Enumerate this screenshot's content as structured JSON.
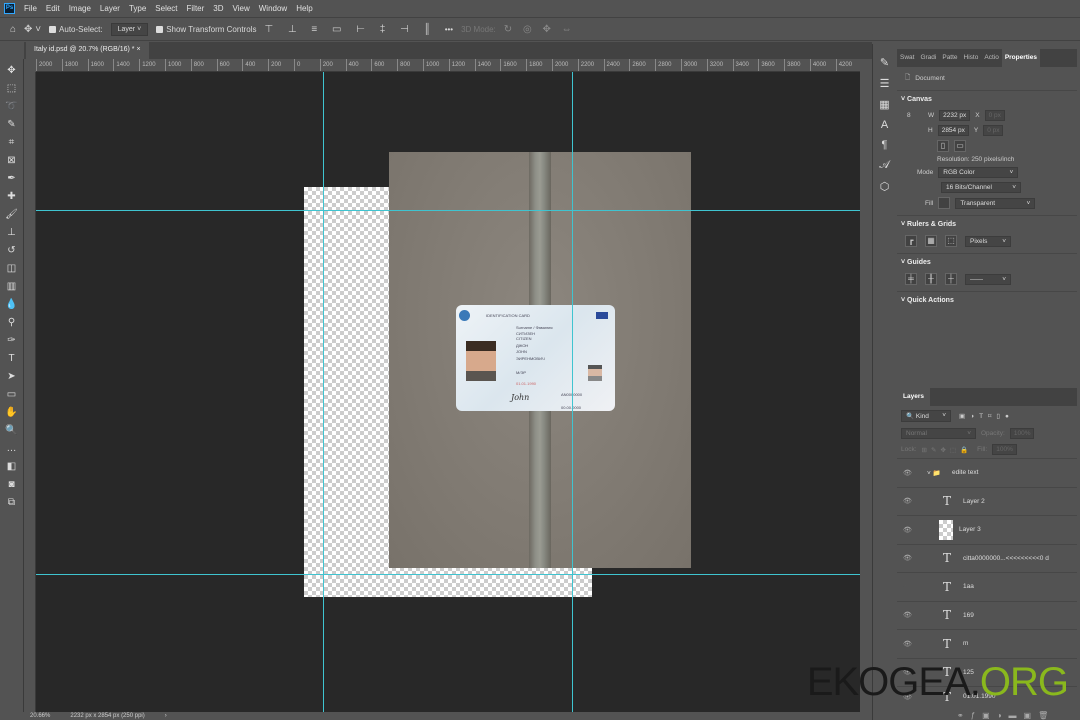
{
  "menu": [
    "File",
    "Edit",
    "Image",
    "Layer",
    "Type",
    "Select",
    "Filter",
    "3D",
    "View",
    "Window",
    "Help"
  ],
  "app_logo": "Ps",
  "options": {
    "auto_select": "Auto-Select:",
    "auto_select_target": "Layer",
    "show_transform": "Show Transform Controls",
    "more": "•••",
    "mode_3d": "3D Mode:"
  },
  "document_tab": {
    "title": "Italy id.psd @ 20.7% (RGB/16) *",
    "close": "×"
  },
  "ruler_ticks": [
    "2000",
    "1800",
    "1600",
    "1400",
    "1200",
    "1000",
    "800",
    "600",
    "400",
    "200",
    "0",
    "200",
    "400",
    "600",
    "800",
    "1000",
    "1200",
    "1400",
    "1600",
    "1800",
    "2000",
    "2200",
    "2400",
    "2600",
    "2800",
    "3000",
    "3200",
    "3400",
    "3600",
    "3800",
    "4000",
    "4200"
  ],
  "status": {
    "zoom": "20.66%",
    "doc_info": "2232 px x 2854 px (250 ppi)",
    "arrow": "›"
  },
  "card": {
    "header": "IDENTIFICATION CARD",
    "l1": "Surname / Фамилия",
    "surname": "СИТИЗЕН",
    "surname_lat": "CITIZEN",
    "given": "ДЖОН",
    "given_lat": "JOHN",
    "patronymic": "ЭИРЕНМОВИЧ",
    "sex": "M/ЭР",
    "dob": "01.01.1990",
    "doc_no": "AN0000000",
    "expiry": "00.00.0000",
    "signature": "John"
  },
  "properties": {
    "tabs": [
      "Swat",
      "Gradi",
      "Patte",
      "Histo",
      "Actio",
      "Properties"
    ],
    "doc_label": "Document",
    "canvas": {
      "title": "Canvas",
      "w_label": "W",
      "w": "2232 px",
      "h_label": "H",
      "h": "2854 px",
      "x_label": "X",
      "x": "0 px",
      "y_label": "Y",
      "y": "0 px",
      "resolution": "Resolution: 250 pixels/inch",
      "mode_label": "Mode",
      "mode": "RGB Color",
      "depth": "16 Bits/Channel",
      "fill_label": "Fill",
      "fill": "Transparent"
    },
    "rulers": {
      "title": "Rulers & Grids",
      "unit": "Pixels"
    },
    "guides": {
      "title": "Guides"
    },
    "quick_actions": {
      "title": "Quick Actions"
    }
  },
  "layers": {
    "title": "Layers",
    "filter": "Kind",
    "blend": "Normal",
    "opacity_label": "Opacity:",
    "opacity": "100%",
    "lock_label": "Lock:",
    "fill_label": "Fill:",
    "fill": "100%",
    "items": [
      {
        "name": "edite text",
        "type": "group"
      },
      {
        "name": "Layer 2",
        "type": "text"
      },
      {
        "name": "Layer 3",
        "type": "image"
      },
      {
        "name": "citta0000000...<<<<<<<<<0 d",
        "type": "text"
      },
      {
        "name": "1aa",
        "type": "text",
        "hidden": true
      },
      {
        "name": "169",
        "type": "text"
      },
      {
        "name": "m",
        "type": "text"
      },
      {
        "name": "125",
        "type": "text"
      },
      {
        "name": "01.01.1990",
        "type": "text"
      }
    ]
  },
  "watermark": {
    "a": "EKOGEA.",
    "b": "ORG"
  }
}
